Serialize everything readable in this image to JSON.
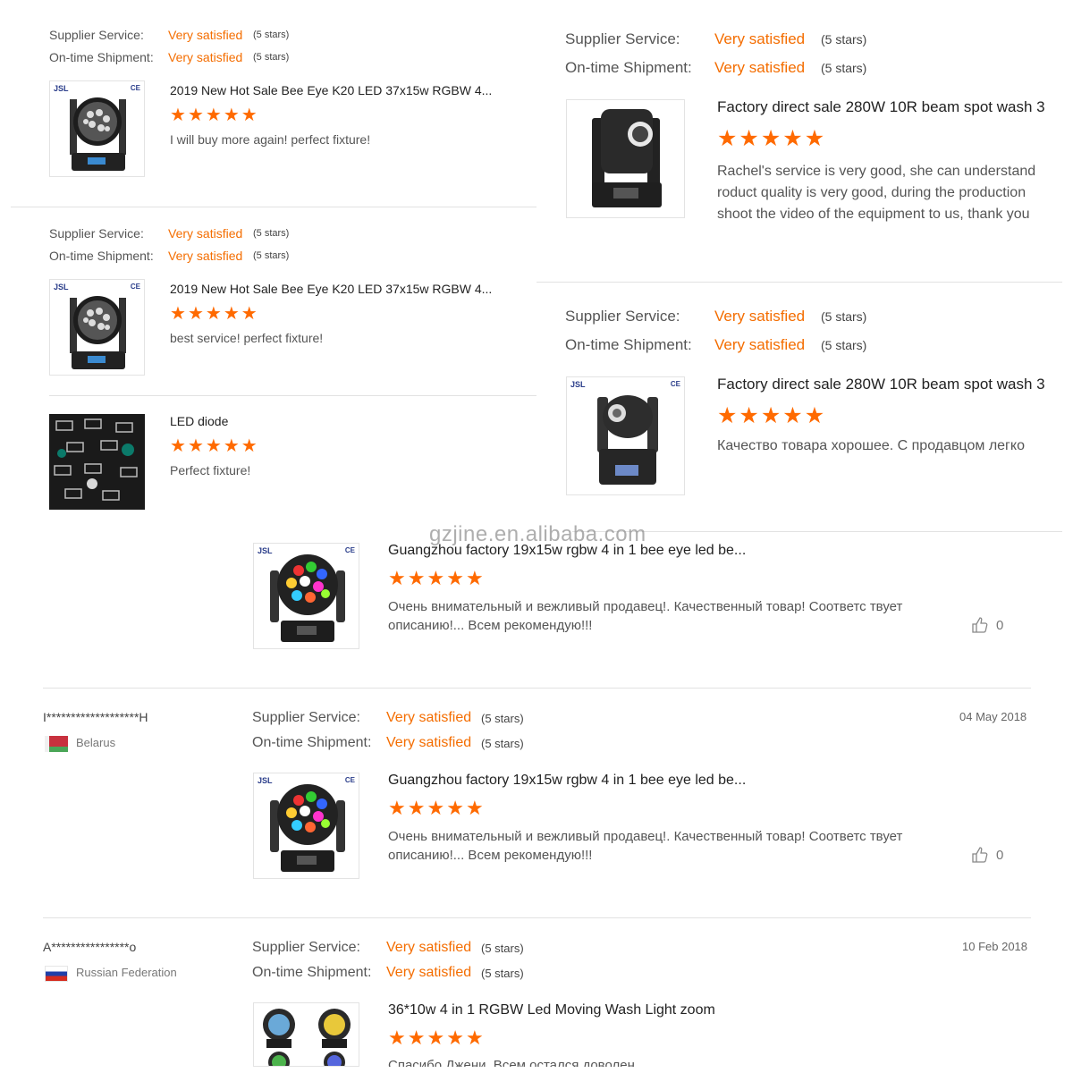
{
  "colors": {
    "accent": "#f46d00",
    "star": "#ff6a00",
    "divider": "#e2e2e2"
  },
  "labels": {
    "supplier_service": "Supplier Service:",
    "ontime_shipment": "On-time Shipment:",
    "very_satisfied": "Very satisfied",
    "five_stars": "(5 stars)"
  },
  "thumb_text": {
    "logo": "JSL",
    "ce": "CE"
  },
  "watermark": "gzjine.en.alibaba.com",
  "reviews": [
    {
      "title": "2019 New Hot Sale Bee Eye K20 LED 37x15w RGBW 4...",
      "rating": 5,
      "comment": "I will buy more again! perfect fixture!"
    },
    {
      "title": "2019 New Hot Sale Bee Eye K20 LED 37x15w RGBW 4...",
      "rating": 5,
      "comment": "best service! perfect fixture!"
    },
    {
      "title": "LED diode",
      "rating": 5,
      "comment": "Perfect fixture!"
    },
    {
      "title": "Factory direct sale 280W 10R beam spot wash 3",
      "rating": 5,
      "comment": "Rachel's service is very good, she can understand roduct quality is very good, during the production shoot the video of the equipment to us, thank you"
    },
    {
      "title": "Factory direct sale 280W 10R beam spot wash 3",
      "rating": 5,
      "comment": "Качество товара хорошее. С продавцом легко"
    },
    {
      "title": "Guangzhou factory 19x15w rgbw 4 in 1 bee eye led be...",
      "rating": 5,
      "comment": "Очень внимательный и вежливый продавец!. Качественный товар! Соответс твует описанию!... Всем рекомендую!!!",
      "likes": "0"
    },
    {
      "reviewer": "I*******************H",
      "country": "Belarus",
      "date": "04 May 2018",
      "title": "Guangzhou factory 19x15w rgbw 4 in 1 bee eye led be...",
      "rating": 5,
      "comment": "Очень внимательный и вежливый продавец!. Качественный товар! Соответс твует описанию!... Всем рекомендую!!!",
      "likes": "0"
    },
    {
      "reviewer": "A****************o",
      "country": "Russian Federation",
      "date": "10 Feb 2018",
      "title": "36*10w 4 in 1 RGBW Led Moving Wash Light zoom",
      "rating": 5,
      "comment": "Спасибо Джени. Всем остался доволен"
    }
  ]
}
